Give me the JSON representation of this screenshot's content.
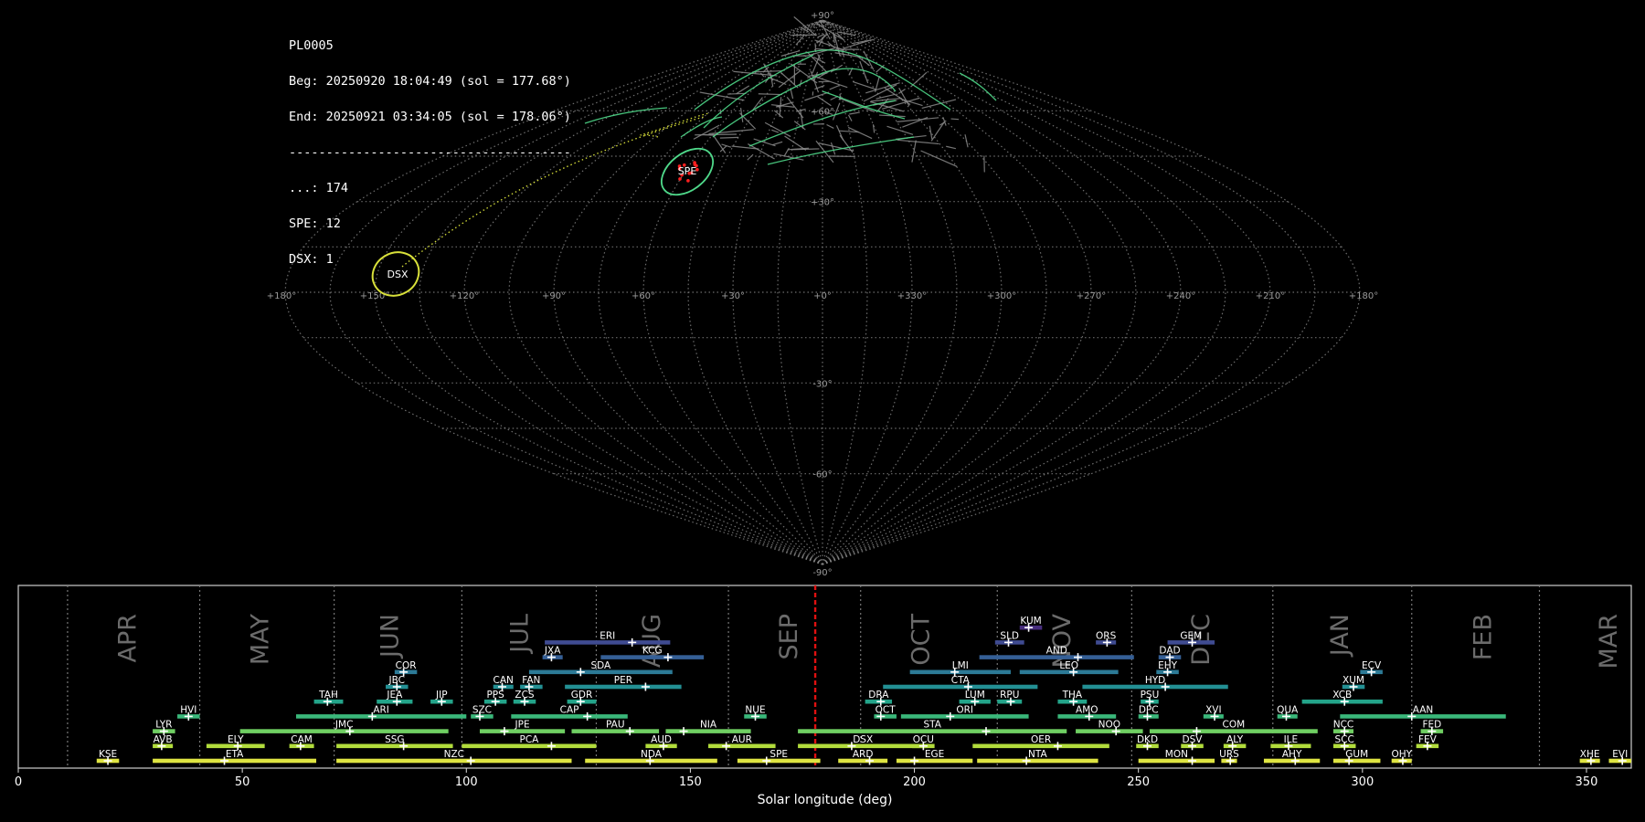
{
  "info": {
    "id": "PL0005",
    "beg": "Beg: 20250920 18:04:49 (sol = 177.68°)",
    "end": "End: 20250921 03:34:05 (sol = 178.06°)",
    "separator": "--------------------------------------",
    "counts": [
      {
        "label": "...",
        "value": "174",
        "text": "...: 174"
      },
      {
        "label": "SPE",
        "value": "12",
        "text": "SPE: 12"
      },
      {
        "label": "DSX",
        "value": "1",
        "text": "DSX: 1"
      }
    ]
  },
  "sky_map": {
    "type": "sinusoidal-projection",
    "lon_labels": [
      "+180°",
      "+150°",
      "+120°",
      "+90°",
      "+60°",
      "+30°",
      "+0°",
      "+330°",
      "+300°",
      "+270°",
      "+240°",
      "+210°",
      "+180°"
    ],
    "lon_values": [
      180,
      150,
      120,
      90,
      60,
      30,
      0,
      330,
      300,
      270,
      240,
      210,
      180
    ],
    "lat_labels": [
      {
        "lat": 90,
        "text": "+90°"
      },
      {
        "lat": 60,
        "text": "+60°"
      },
      {
        "lat": 30,
        "text": "+30°"
      },
      {
        "lat": -30,
        "text": "-30°"
      },
      {
        "lat": -60,
        "text": "-60°"
      },
      {
        "lat": -90,
        "text": "-90°"
      }
    ],
    "showers": [
      {
        "code": "SPE",
        "lon": 50,
        "lat": 40,
        "color": "#4fd98a"
      },
      {
        "code": "DSX",
        "lon": 155,
        "lat": 6,
        "color": "#d8e03a"
      }
    ],
    "colors": {
      "grid": "#888888",
      "meteor": "#8a8a8a",
      "spe": "#4fd98a",
      "dsx": "#d8e03a",
      "spe_points": "#ff2020"
    }
  },
  "chart_data": {
    "type": "timeline",
    "xlabel": "Solar longitude (deg)",
    "xlim": [
      0,
      360
    ],
    "xticks": [
      0,
      50,
      100,
      150,
      200,
      250,
      300,
      350
    ],
    "current_sol": 177.87,
    "month_separators": [
      11,
      40.5,
      70.5,
      99,
      129,
      158.5,
      188,
      218.5,
      248.5,
      280,
      311,
      339.5
    ],
    "months": [
      {
        "name": "APR",
        "sol": 24.5
      },
      {
        "name": "MAY",
        "sol": 54
      },
      {
        "name": "JUN",
        "sol": 83
      },
      {
        "name": "JUL",
        "sol": 112
      },
      {
        "name": "AUG",
        "sol": 141.5
      },
      {
        "name": "SEP",
        "sol": 172
      },
      {
        "name": "OCT",
        "sol": 201.5
      },
      {
        "name": "NOV",
        "sol": 233
      },
      {
        "name": "DEC",
        "sol": 264
      },
      {
        "name": "JAN",
        "sol": 295
      },
      {
        "name": "FEB",
        "sol": 327
      },
      {
        "name": "MAR",
        "sol": 355
      }
    ],
    "showers": [
      {
        "code": "KSE",
        "start": 17.5,
        "end": 22.5,
        "peak": 20,
        "row": 0
      },
      {
        "code": "ETA",
        "start": 30,
        "end": 66.5,
        "peak": 46,
        "row": 0
      },
      {
        "code": "NZC",
        "start": 71,
        "end": 123.5,
        "peak": 101,
        "row": 0
      },
      {
        "code": "NDA",
        "start": 126.5,
        "end": 156,
        "peak": 141,
        "row": 0
      },
      {
        "code": "SPE",
        "start": 160.5,
        "end": 179,
        "peak": 167,
        "row": 0
      },
      {
        "code": "ARD",
        "start": 183,
        "end": 194,
        "peak": 190,
        "row": 0
      },
      {
        "code": "EGE",
        "start": 196,
        "end": 213,
        "peak": 200,
        "row": 0
      },
      {
        "code": "NTA",
        "start": 214,
        "end": 241,
        "peak": 225,
        "row": 0
      },
      {
        "code": "MON",
        "start": 250,
        "end": 267,
        "peak": 262,
        "row": 0
      },
      {
        "code": "URS",
        "start": 268.5,
        "end": 272,
        "peak": 270.5,
        "row": 0
      },
      {
        "code": "AHY",
        "start": 278,
        "end": 290.5,
        "peak": 285,
        "row": 0
      },
      {
        "code": "GUM",
        "start": 293.5,
        "end": 304,
        "peak": 297,
        "row": 0
      },
      {
        "code": "OHY",
        "start": 306.5,
        "end": 311,
        "peak": 309,
        "row": 0
      },
      {
        "code": "XHE",
        "start": 348.5,
        "end": 353,
        "peak": 351,
        "row": 0
      },
      {
        "code": "EVI",
        "start": 355,
        "end": 360,
        "peak": 358,
        "row": 0
      },
      {
        "code": "AVB",
        "start": 30,
        "end": 34.5,
        "peak": 32,
        "row": 1
      },
      {
        "code": "ELY",
        "start": 42,
        "end": 55,
        "peak": 49,
        "row": 1
      },
      {
        "code": "CAM",
        "start": 60.5,
        "end": 66,
        "peak": 63,
        "row": 1
      },
      {
        "code": "SSG",
        "start": 71,
        "end": 97,
        "peak": 86,
        "row": 1
      },
      {
        "code": "PCA",
        "start": 99,
        "end": 129,
        "peak": 119,
        "row": 1
      },
      {
        "code": "AUD",
        "start": 140,
        "end": 147,
        "peak": 144,
        "row": 1
      },
      {
        "code": "AUR",
        "start": 154,
        "end": 169,
        "peak": 158,
        "row": 1
      },
      {
        "code": "DSX",
        "start": 174,
        "end": 203,
        "peak": 186,
        "row": 1
      },
      {
        "code": "OCU",
        "start": 199.5,
        "end": 204.5,
        "peak": 202,
        "row": 1
      },
      {
        "code": "OER",
        "start": 213,
        "end": 243.5,
        "peak": 232,
        "row": 1
      },
      {
        "code": "DKD",
        "start": 249.5,
        "end": 254.5,
        "peak": 252,
        "row": 1
      },
      {
        "code": "DSV",
        "start": 259.5,
        "end": 264.5,
        "peak": 262,
        "row": 1
      },
      {
        "code": "ALY",
        "start": 269,
        "end": 274,
        "peak": 271,
        "row": 1
      },
      {
        "code": "ILE",
        "start": 279.5,
        "end": 288.5,
        "peak": 283.5,
        "row": 1
      },
      {
        "code": "SCC",
        "start": 293.5,
        "end": 298.5,
        "peak": 296,
        "row": 1
      },
      {
        "code": "FEV",
        "start": 312,
        "end": 317,
        "peak": 314.5,
        "row": 1
      },
      {
        "code": "LYR",
        "start": 30,
        "end": 35,
        "peak": 32.5,
        "row": 2
      },
      {
        "code": "JMC",
        "start": 49.5,
        "end": 96,
        "peak": 74,
        "row": 2
      },
      {
        "code": "JPE",
        "start": 103,
        "end": 122,
        "peak": 108.5,
        "row": 2
      },
      {
        "code": "PAU",
        "start": 123.5,
        "end": 143,
        "peak": 136.5,
        "row": 2
      },
      {
        "code": "NIA",
        "start": 144.5,
        "end": 163.5,
        "peak": 148.5,
        "row": 2
      },
      {
        "code": "STA",
        "start": 174,
        "end": 234,
        "peak": 216,
        "row": 2
      },
      {
        "code": "NOO",
        "start": 236,
        "end": 251,
        "peak": 245,
        "row": 2
      },
      {
        "code": "COM",
        "start": 252.5,
        "end": 290,
        "peak": 263,
        "row": 2
      },
      {
        "code": "NCC",
        "start": 293.5,
        "end": 298,
        "peak": 296,
        "row": 2
      },
      {
        "code": "FED",
        "start": 313,
        "end": 318,
        "peak": 315.5,
        "row": 2
      },
      {
        "code": "HVI",
        "start": 35.5,
        "end": 40.5,
        "peak": 38,
        "row": 3
      },
      {
        "code": "ARI",
        "start": 62,
        "end": 100,
        "peak": 79,
        "row": 3
      },
      {
        "code": "SZC",
        "start": 101,
        "end": 106,
        "peak": 103,
        "row": 3
      },
      {
        "code": "CAP",
        "start": 110,
        "end": 136,
        "peak": 127,
        "row": 3
      },
      {
        "code": "NUE",
        "start": 162,
        "end": 167,
        "peak": 164.5,
        "row": 3
      },
      {
        "code": "OCT",
        "start": 191,
        "end": 196,
        "peak": 192.5,
        "row": 3
      },
      {
        "code": "ORI",
        "start": 197,
        "end": 225.5,
        "peak": 208,
        "row": 3
      },
      {
        "code": "AMO",
        "start": 232,
        "end": 245,
        "peak": 239,
        "row": 3
      },
      {
        "code": "DPC",
        "start": 250,
        "end": 254.5,
        "peak": 252,
        "row": 3
      },
      {
        "code": "XVI",
        "start": 264.5,
        "end": 269,
        "peak": 267,
        "row": 3
      },
      {
        "code": "QUA",
        "start": 281,
        "end": 285.5,
        "peak": 283,
        "row": 3
      },
      {
        "code": "AAN",
        "start": 295,
        "end": 332,
        "peak": 311,
        "row": 3
      },
      {
        "code": "TAH",
        "start": 66,
        "end": 72.5,
        "peak": 69,
        "row": 4
      },
      {
        "code": "JEA",
        "start": 80,
        "end": 88,
        "peak": 84.5,
        "row": 4
      },
      {
        "code": "JIP",
        "start": 92,
        "end": 97,
        "peak": 94.5,
        "row": 4
      },
      {
        "code": "PPS",
        "start": 104,
        "end": 109,
        "peak": 106.5,
        "row": 4
      },
      {
        "code": "ZCS",
        "start": 110.5,
        "end": 115.5,
        "peak": 113,
        "row": 4
      },
      {
        "code": "GDR",
        "start": 122.5,
        "end": 129,
        "peak": 125.5,
        "row": 4
      },
      {
        "code": "DRA",
        "start": 189,
        "end": 195,
        "peak": 192.5,
        "row": 4
      },
      {
        "code": "LUM",
        "start": 210,
        "end": 217,
        "peak": 213.5,
        "row": 4
      },
      {
        "code": "RPU",
        "start": 218.5,
        "end": 224,
        "peak": 221.5,
        "row": 4
      },
      {
        "code": "THA",
        "start": 232,
        "end": 238.5,
        "peak": 235.5,
        "row": 4
      },
      {
        "code": "PSU",
        "start": 250.5,
        "end": 254.5,
        "peak": 252.5,
        "row": 4
      },
      {
        "code": "XCB",
        "start": 286.5,
        "end": 304.5,
        "peak": 296,
        "row": 4
      },
      {
        "code": "JBC",
        "start": 82,
        "end": 87,
        "peak": 84.5,
        "row": 5
      },
      {
        "code": "CAN",
        "start": 106,
        "end": 110.5,
        "peak": 108,
        "row": 5
      },
      {
        "code": "FAN",
        "start": 112,
        "end": 117,
        "peak": 114,
        "row": 5
      },
      {
        "code": "PER",
        "start": 122,
        "end": 148,
        "peak": 140,
        "row": 5
      },
      {
        "code": "CTA",
        "start": 193,
        "end": 227.5,
        "peak": 212,
        "row": 5
      },
      {
        "code": "HYD",
        "start": 237.5,
        "end": 270,
        "peak": 256,
        "row": 5
      },
      {
        "code": "XUM",
        "start": 295.5,
        "end": 300.5,
        "peak": 298,
        "row": 5
      },
      {
        "code": "COR",
        "start": 84,
        "end": 89,
        "peak": 86,
        "row": 6
      },
      {
        "code": "SDA",
        "start": 114,
        "end": 146,
        "peak": 125.5,
        "row": 6
      },
      {
        "code": "LMI",
        "start": 199,
        "end": 221.5,
        "peak": 209,
        "row": 6
      },
      {
        "code": "LEO",
        "start": 223.5,
        "end": 245.5,
        "peak": 235.5,
        "row": 6
      },
      {
        "code": "EHY",
        "start": 254,
        "end": 259,
        "peak": 256.5,
        "row": 6
      },
      {
        "code": "ECV",
        "start": 299.5,
        "end": 304.5,
        "peak": 302,
        "row": 6
      },
      {
        "code": "JXA",
        "start": 117,
        "end": 121.5,
        "peak": 119,
        "row": 7
      },
      {
        "code": "KCG",
        "start": 130,
        "end": 153,
        "peak": 145,
        "row": 7
      },
      {
        "code": "AND",
        "start": 214.5,
        "end": 249,
        "peak": 236.5,
        "row": 7
      },
      {
        "code": "DAD",
        "start": 254.5,
        "end": 259.5,
        "peak": 257,
        "row": 7
      },
      {
        "code": "ERI",
        "start": 117.5,
        "end": 145.5,
        "peak": 137,
        "row": 8
      },
      {
        "code": "SLD",
        "start": 218,
        "end": 224.5,
        "peak": 221,
        "row": 8
      },
      {
        "code": "ORS",
        "start": 240.5,
        "end": 245,
        "peak": 243,
        "row": 8
      },
      {
        "code": "GEM",
        "start": 256.5,
        "end": 267,
        "peak": 262,
        "row": 8
      },
      {
        "code": "KUM",
        "start": 223.5,
        "end": 228.5,
        "peak": 225.5,
        "row": 9
      }
    ]
  }
}
